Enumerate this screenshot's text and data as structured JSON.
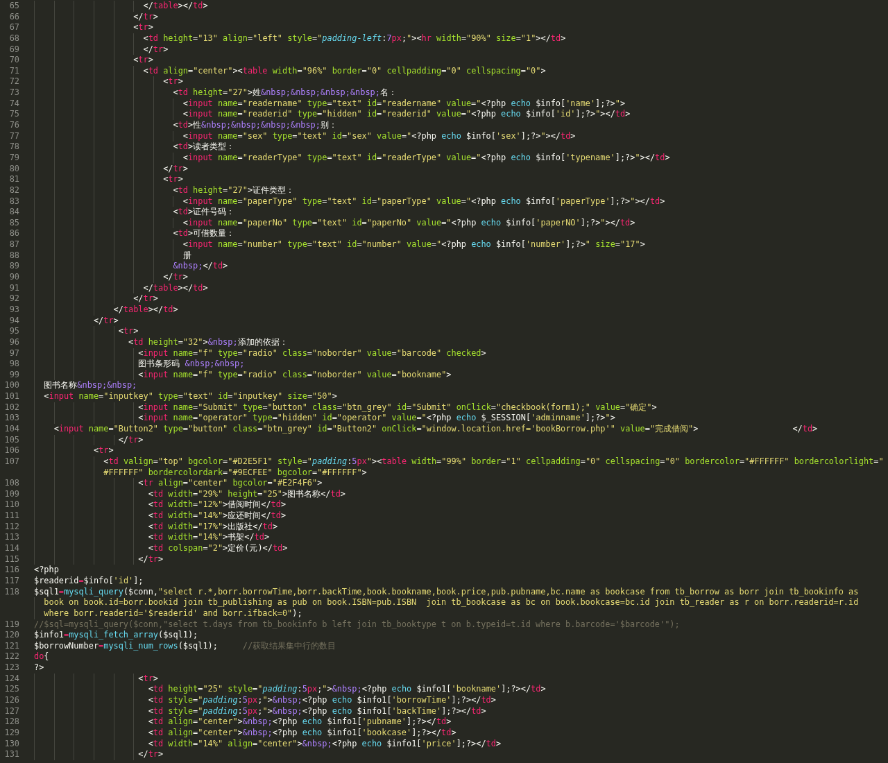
{
  "editor": {
    "lines": [
      {
        "number": "65",
        "kind": "markup",
        "text": "                      </table></td>"
      },
      {
        "number": "66",
        "kind": "markup",
        "text": "                    </tr>"
      },
      {
        "number": "67",
        "kind": "markup",
        "text": "                    <tr>"
      },
      {
        "number": "68",
        "kind": "markup",
        "text": "                      <td height=\"13\" align=\"left\" style=\"padding-left:7px;\"><hr width=\"90%\" size=\"1\"></td>"
      },
      {
        "number": "69",
        "kind": "markup",
        "text": "                      </tr>"
      },
      {
        "number": "70",
        "kind": "markup",
        "text": "                    <tr>"
      },
      {
        "number": "71",
        "kind": "markup",
        "text": "                      <td align=\"center\"><table width=\"96%\" border=\"0\" cellpadding=\"0\" cellspacing=\"0\">"
      },
      {
        "number": "72",
        "kind": "markup",
        "text": "                          <tr>"
      },
      {
        "number": "73",
        "kind": "markup",
        "text": "                            <td height=\"27\">姓&nbsp;&nbsp;&nbsp;&nbsp;名："
      },
      {
        "number": "74",
        "kind": "markup",
        "text": "                              <input name=\"readername\" type=\"text\" id=\"readername\" value=\"<?php echo $info['name'];?>\">"
      },
      {
        "number": "75",
        "kind": "markup",
        "text": "                              <input name=\"readerid\" type=\"hidden\" id=\"readerid\" value=\"<?php echo $info['id'];?>\"></td>"
      },
      {
        "number": "76",
        "kind": "markup",
        "text": "                            <td>性&nbsp;&nbsp;&nbsp;&nbsp;别："
      },
      {
        "number": "77",
        "kind": "markup",
        "text": "                              <input name=\"sex\" type=\"text\" id=\"sex\" value=\"<?php echo $info['sex'];?>\"></td>"
      },
      {
        "number": "78",
        "kind": "markup",
        "text": "                            <td>读者类型："
      },
      {
        "number": "79",
        "kind": "markup",
        "text": "                              <input name=\"readerType\" type=\"text\" id=\"readerType\" value=\"<?php echo $info['typename'];?>\"></td>"
      },
      {
        "number": "80",
        "kind": "markup",
        "text": "                          </tr>"
      },
      {
        "number": "81",
        "kind": "markup",
        "text": "                          <tr>"
      },
      {
        "number": "82",
        "kind": "markup",
        "text": "                            <td height=\"27\">证件类型："
      },
      {
        "number": "83",
        "kind": "markup",
        "text": "                              <input name=\"paperType\" type=\"text\" id=\"paperType\" value=\"<?php echo $info['paperType'];?>\"></td>"
      },
      {
        "number": "84",
        "kind": "markup",
        "text": "                            <td>证件号码："
      },
      {
        "number": "85",
        "kind": "markup",
        "text": "                              <input name=\"paperNo\" type=\"text\" id=\"paperNo\" value=\"<?php echo $info['paperNO'];?>\"></td>"
      },
      {
        "number": "86",
        "kind": "markup",
        "text": "                            <td>可借数量："
      },
      {
        "number": "87",
        "kind": "markup",
        "text": "                              <input name=\"number\" type=\"text\" id=\"number\" value=\"<?php echo $info['number'];?>\" size=\"17\">"
      },
      {
        "number": "88",
        "kind": "markup",
        "text": "                              册"
      },
      {
        "number": "89",
        "kind": "markup",
        "text": "                            &nbsp;</td>"
      },
      {
        "number": "90",
        "kind": "markup",
        "text": "                          </tr>"
      },
      {
        "number": "91",
        "kind": "markup",
        "text": "                      </table></td>"
      },
      {
        "number": "92",
        "kind": "markup",
        "text": "                    </tr>"
      },
      {
        "number": "93",
        "kind": "markup",
        "text": "                </table></td>"
      },
      {
        "number": "94",
        "kind": "markup",
        "text": "            </tr>"
      },
      {
        "number": "95",
        "kind": "markup",
        "text": "                 <tr>"
      },
      {
        "number": "96",
        "kind": "markup",
        "text": "                   <td height=\"32\">&nbsp;添加的依据："
      },
      {
        "number": "97",
        "kind": "markup",
        "text": "                     <input name=\"f\" type=\"radio\" class=\"noborder\" value=\"barcode\" checked>"
      },
      {
        "number": "98",
        "kind": "markup",
        "text": "                     图书条形码 &nbsp;&nbsp;"
      },
      {
        "number": "99",
        "kind": "markup",
        "text": "                     <input name=\"f\" type=\"radio\" class=\"noborder\" value=\"bookname\">"
      },
      {
        "number": "100",
        "kind": "markup",
        "text": "  图书名称&nbsp;&nbsp;"
      },
      {
        "number": "101",
        "kind": "markup",
        "text": "  <input name=\"inputkey\" type=\"text\" id=\"inputkey\" size=\"50\">"
      },
      {
        "number": "102",
        "kind": "markup",
        "text": "                     <input name=\"Submit\" type=\"button\" class=\"btn_grey\" id=\"Submit\" onClick=\"checkbook(form1);\" value=\"确定\">"
      },
      {
        "number": "103",
        "kind": "markup",
        "text": "                     <input name=\"operator\" type=\"hidden\" id=\"operator\" value=\"<?php echo $_SESSION['adminname'];?>\">"
      },
      {
        "number": "104",
        "kind": "markup",
        "text": "    <input name=\"Button2\" type=\"button\" class=\"btn_grey\" id=\"Button2\" onClick=\"window.location.href='bookBorrow.php'\" value=\"完成借阅\">                   </td>"
      },
      {
        "number": "105",
        "kind": "markup",
        "text": "                 </tr>"
      },
      {
        "number": "106",
        "kind": "markup",
        "text": "            <tr>"
      },
      {
        "number": "107",
        "kind": "markup",
        "text": "              <td valign=\"top\" bgcolor=\"#D2E5F1\" style=\"padding:5px\"><table width=\"99%\" border=\"1\" cellpadding=\"0\" cellspacing=\"0\" bordercolor=\"#FFFFFF\" bordercolorlight=\"",
        "wraps": [
          "              #FFFFFF\" bordercolordark=\"#9ECFEE\" bgcolor=\"#FFFFFF\">"
        ]
      },
      {
        "number": "108",
        "kind": "markup",
        "text": "                     <tr align=\"center\" bgcolor=\"#E2F4F6\">"
      },
      {
        "number": "109",
        "kind": "markup",
        "text": "                       <td width=\"29%\" height=\"25\">图书名称</td>"
      },
      {
        "number": "110",
        "kind": "markup",
        "text": "                       <td width=\"12%\">借阅时间</td>"
      },
      {
        "number": "111",
        "kind": "markup",
        "text": "                       <td width=\"14%\">应还时间</td>"
      },
      {
        "number": "112",
        "kind": "markup",
        "text": "                       <td width=\"17%\">出版社</td>"
      },
      {
        "number": "113",
        "kind": "markup",
        "text": "                       <td width=\"14%\">书架</td>"
      },
      {
        "number": "114",
        "kind": "markup",
        "text": "                       <td colspan=\"2\">定价(元)</td>"
      },
      {
        "number": "115",
        "kind": "markup",
        "text": "                     </tr>"
      },
      {
        "number": "116",
        "kind": "php",
        "text": "<?php"
      },
      {
        "number": "117",
        "kind": "php",
        "text": "$readerid=$info['id'];"
      },
      {
        "number": "118",
        "kind": "php",
        "text": "$sql1=mysqli_query($conn,\"select r.*,borr.borrowTime,borr.backTime,book.bookname,book.price,pub.pubname,bc.name as bookcase from tb_borrow as borr join tb_bookinfo as",
        "wraps": [
          "  book on book.id=borr.bookid join tb_publishing as pub on book.ISBN=pub.ISBN  join tb_bookcase as bc on book.bookcase=bc.id join tb_reader as r on borr.readerid=r.id",
          "  where borr.readerid='$readerid' and borr.ifback=0\");"
        ]
      },
      {
        "number": "119",
        "kind": "php",
        "text": "//$sql=mysqli_query($conn,\"select t.days from tb_bookinfo b left join tb_booktype t on b.typeid=t.id where b.barcode='$barcode'\");"
      },
      {
        "number": "120",
        "kind": "php",
        "text": "$info1=mysqli_fetch_array($sql1);"
      },
      {
        "number": "121",
        "kind": "php",
        "text": "$borrowNumber=mysqli_num_rows($sql1);     //获取结果集中行的数目"
      },
      {
        "number": "122",
        "kind": "php",
        "text": "do{"
      },
      {
        "number": "123",
        "kind": "php",
        "text": "?>"
      },
      {
        "number": "124",
        "kind": "markup",
        "text": "                     <tr>"
      },
      {
        "number": "125",
        "kind": "markup",
        "text": "                       <td height=\"25\" style=\"padding:5px;\">&nbsp;<?php echo $info1['bookname'];?></td>"
      },
      {
        "number": "126",
        "kind": "markup",
        "text": "                       <td style=\"padding:5px;\">&nbsp;<?php echo $info1['borrowTime'];?></td>"
      },
      {
        "number": "127",
        "kind": "markup",
        "text": "                       <td style=\"padding:5px;\">&nbsp;<?php echo $info1['backTime'];?></td>"
      },
      {
        "number": "128",
        "kind": "markup",
        "text": "                       <td align=\"center\">&nbsp;<?php echo $info1['pubname'];?></td>"
      },
      {
        "number": "129",
        "kind": "markup",
        "text": "                       <td align=\"center\">&nbsp;<?php echo $info1['bookcase'];?></td>"
      },
      {
        "number": "130",
        "kind": "markup",
        "text": "                       <td width=\"14%\" align=\"center\">&nbsp;<?php echo $info1['price'];?></td>"
      },
      {
        "number": "131",
        "kind": "markup",
        "text": "                     </tr>"
      }
    ]
  }
}
